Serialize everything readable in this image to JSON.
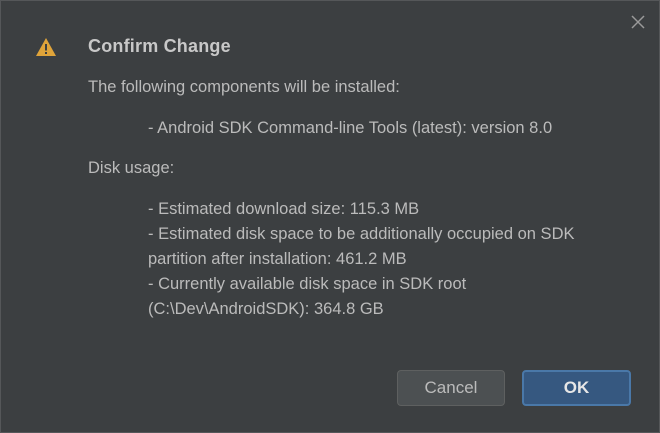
{
  "dialog": {
    "title": "Confirm Change",
    "intro": "The following components will be installed:",
    "components": [
      "- Android SDK Command-line Tools (latest): version 8.0"
    ],
    "disk_usage_label": "Disk usage:",
    "disk_usage_lines": [
      "- Estimated download size: 115.3 MB",
      "- Estimated disk space to be additionally occupied on SDK",
      "partition after installation: 461.2 MB",
      "- Currently available disk space in SDK root",
      "(C:\\Dev\\AndroidSDK): 364.8 GB"
    ],
    "cancel_label": "Cancel",
    "ok_label": "OK",
    "icons": {
      "title_icon": "warning-icon",
      "close_icon": "close-icon"
    },
    "colors": {
      "background": "#3c3f41",
      "warning": "#e0a43a",
      "default_button": "#365880"
    }
  }
}
